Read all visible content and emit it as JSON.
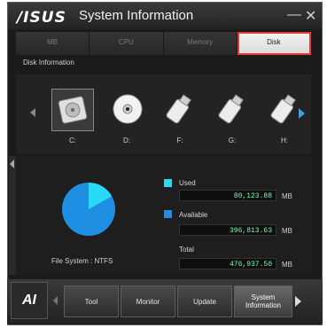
{
  "window": {
    "brand": "/ISUS",
    "title": "System Information"
  },
  "tabs": [
    {
      "label": "MB"
    },
    {
      "label": "CPU"
    },
    {
      "label": "Memory"
    },
    {
      "label": "Disk"
    }
  ],
  "section_label": "Disk Information",
  "drives": [
    {
      "label": "C:",
      "icon": "hard-drive-icon"
    },
    {
      "label": "D:",
      "icon": "optical-disc-icon"
    },
    {
      "label": "F:",
      "icon": "usb-drive-icon"
    },
    {
      "label": "G:",
      "icon": "usb-drive-icon"
    },
    {
      "label": "H:",
      "icon": "usb-drive-icon"
    }
  ],
  "usage": {
    "used_label": "Used",
    "used_value": "80,123.88",
    "available_label": "Available",
    "available_value": "396,813.63",
    "total_label": "Total",
    "total_value": "476,937.50",
    "unit": "MB",
    "file_system": "File System : NTFS",
    "used_fraction": 0.168,
    "colors": {
      "used": "#2ad8f8",
      "available": "#1e8fe3"
    }
  },
  "bottom_nav": {
    "items": [
      {
        "label": "Tool"
      },
      {
        "label": "Monitor"
      },
      {
        "label": "Update"
      },
      {
        "label": "System Information"
      }
    ]
  }
}
